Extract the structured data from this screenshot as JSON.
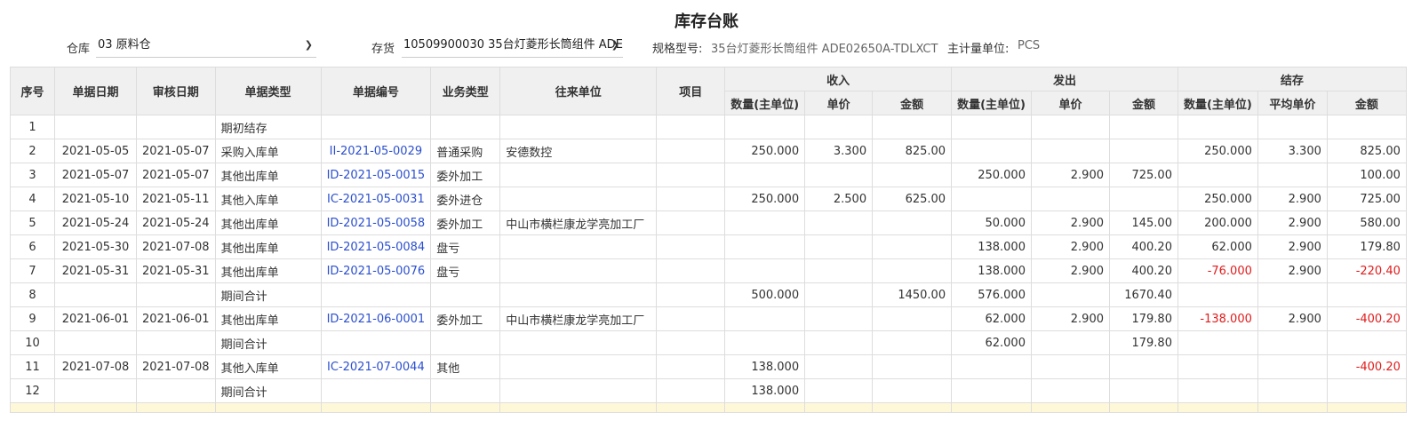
{
  "title": "库存台账",
  "filters": {
    "warehouse_label": "仓库",
    "warehouse_value": "03 原料仓",
    "inventory_label": "存货",
    "inventory_value": "10509900030 35台灯菱形长筒组件 ADE(",
    "spec_label": "规格型号:",
    "spec_value": "35台灯菱形长筒组件 ADE02650A-TDLXCT",
    "unit_label": "主计量单位:",
    "unit_value": "PCS"
  },
  "headers": {
    "seq": "序号",
    "doc_date": "单据日期",
    "audit_date": "审核日期",
    "doc_type": "单据类型",
    "doc_no": "单据编号",
    "biz_type": "业务类型",
    "partner": "往来单位",
    "project": "项目",
    "in": "收入",
    "out": "发出",
    "bal": "结存",
    "qty": "数量(主单位)",
    "price": "单价",
    "amount": "金额",
    "avg_price": "平均单价"
  },
  "rows": [
    {
      "seq": "1",
      "doc_date": "",
      "audit_date": "",
      "doc_type": "期初结存",
      "doc_no": "",
      "biz_type": "",
      "partner": "",
      "project": "",
      "in_qty": "",
      "in_price": "",
      "in_amt": "",
      "out_qty": "",
      "out_price": "",
      "out_amt": "",
      "bal_qty": "",
      "bal_price": "",
      "bal_amt": ""
    },
    {
      "seq": "2",
      "doc_date": "2021-05-05",
      "audit_date": "2021-05-07",
      "doc_type": "采购入库单",
      "doc_no": "II-2021-05-0029",
      "biz_type": "普通采购",
      "partner": "安德数控",
      "project": "",
      "in_qty": "250.000",
      "in_price": "3.300",
      "in_amt": "825.00",
      "out_qty": "",
      "out_price": "",
      "out_amt": "",
      "bal_qty": "250.000",
      "bal_price": "3.300",
      "bal_amt": "825.00"
    },
    {
      "seq": "3",
      "doc_date": "2021-05-07",
      "audit_date": "2021-05-07",
      "doc_type": "其他出库单",
      "doc_no": "ID-2021-05-0015",
      "biz_type": "委外加工",
      "partner": "",
      "project": "",
      "in_qty": "",
      "in_price": "",
      "in_amt": "",
      "out_qty": "250.000",
      "out_price": "2.900",
      "out_amt": "725.00",
      "bal_qty": "",
      "bal_price": "",
      "bal_amt": "100.00"
    },
    {
      "seq": "4",
      "doc_date": "2021-05-10",
      "audit_date": "2021-05-11",
      "doc_type": "其他入库单",
      "doc_no": "IC-2021-05-0031",
      "biz_type": "委外进仓",
      "partner": "",
      "project": "",
      "in_qty": "250.000",
      "in_price": "2.500",
      "in_amt": "625.00",
      "out_qty": "",
      "out_price": "",
      "out_amt": "",
      "bal_qty": "250.000",
      "bal_price": "2.900",
      "bal_amt": "725.00"
    },
    {
      "seq": "5",
      "doc_date": "2021-05-24",
      "audit_date": "2021-05-24",
      "doc_type": "其他出库单",
      "doc_no": "ID-2021-05-0058",
      "biz_type": "委外加工",
      "partner": "中山市横栏康龙学亮加工厂",
      "project": "",
      "in_qty": "",
      "in_price": "",
      "in_amt": "",
      "out_qty": "50.000",
      "out_price": "2.900",
      "out_amt": "145.00",
      "bal_qty": "200.000",
      "bal_price": "2.900",
      "bal_amt": "580.00"
    },
    {
      "seq": "6",
      "doc_date": "2021-05-30",
      "audit_date": "2021-07-08",
      "doc_type": "其他出库单",
      "doc_no": "ID-2021-05-0084",
      "biz_type": "盘亏",
      "partner": "",
      "project": "",
      "in_qty": "",
      "in_price": "",
      "in_amt": "",
      "out_qty": "138.000",
      "out_price": "2.900",
      "out_amt": "400.20",
      "bal_qty": "62.000",
      "bal_price": "2.900",
      "bal_amt": "179.80"
    },
    {
      "seq": "7",
      "doc_date": "2021-05-31",
      "audit_date": "2021-05-31",
      "doc_type": "其他出库单",
      "doc_no": "ID-2021-05-0076",
      "biz_type": "盘亏",
      "partner": "",
      "project": "",
      "in_qty": "",
      "in_price": "",
      "in_amt": "",
      "out_qty": "138.000",
      "out_price": "2.900",
      "out_amt": "400.20",
      "bal_qty": "-76.000",
      "bal_price": "2.900",
      "bal_amt": "-220.40"
    },
    {
      "seq": "8",
      "doc_date": "",
      "audit_date": "",
      "doc_type": "期间合计",
      "doc_no": "",
      "biz_type": "",
      "partner": "",
      "project": "",
      "in_qty": "500.000",
      "in_price": "",
      "in_amt": "1450.00",
      "out_qty": "576.000",
      "out_price": "",
      "out_amt": "1670.40",
      "bal_qty": "",
      "bal_price": "",
      "bal_amt": ""
    },
    {
      "seq": "9",
      "doc_date": "2021-06-01",
      "audit_date": "2021-06-01",
      "doc_type": "其他出库单",
      "doc_no": "ID-2021-06-0001",
      "biz_type": "委外加工",
      "partner": "中山市横栏康龙学亮加工厂",
      "project": "",
      "in_qty": "",
      "in_price": "",
      "in_amt": "",
      "out_qty": "62.000",
      "out_price": "2.900",
      "out_amt": "179.80",
      "bal_qty": "-138.000",
      "bal_price": "2.900",
      "bal_amt": "-400.20"
    },
    {
      "seq": "10",
      "doc_date": "",
      "audit_date": "",
      "doc_type": "期间合计",
      "doc_no": "",
      "biz_type": "",
      "partner": "",
      "project": "",
      "in_qty": "",
      "in_price": "",
      "in_amt": "",
      "out_qty": "62.000",
      "out_price": "",
      "out_amt": "179.80",
      "bal_qty": "",
      "bal_price": "",
      "bal_amt": ""
    },
    {
      "seq": "11",
      "doc_date": "2021-07-08",
      "audit_date": "2021-07-08",
      "doc_type": "其他入库单",
      "doc_no": "IC-2021-07-0044",
      "biz_type": "其他",
      "partner": "",
      "project": "",
      "in_qty": "138.000",
      "in_price": "",
      "in_amt": "",
      "out_qty": "",
      "out_price": "",
      "out_amt": "",
      "bal_qty": "",
      "bal_price": "",
      "bal_amt": "-400.20"
    },
    {
      "seq": "12",
      "doc_date": "",
      "audit_date": "",
      "doc_type": "期间合计",
      "doc_no": "",
      "biz_type": "",
      "partner": "",
      "project": "",
      "in_qty": "138.000",
      "in_price": "",
      "in_amt": "",
      "out_qty": "",
      "out_price": "",
      "out_amt": "",
      "bal_qty": "",
      "bal_price": "",
      "bal_amt": ""
    }
  ],
  "colors": {
    "link": "#2b4fd0",
    "negative": "#e21b1b",
    "header_bg": "#f0f0f0",
    "border": "#dddddd"
  }
}
